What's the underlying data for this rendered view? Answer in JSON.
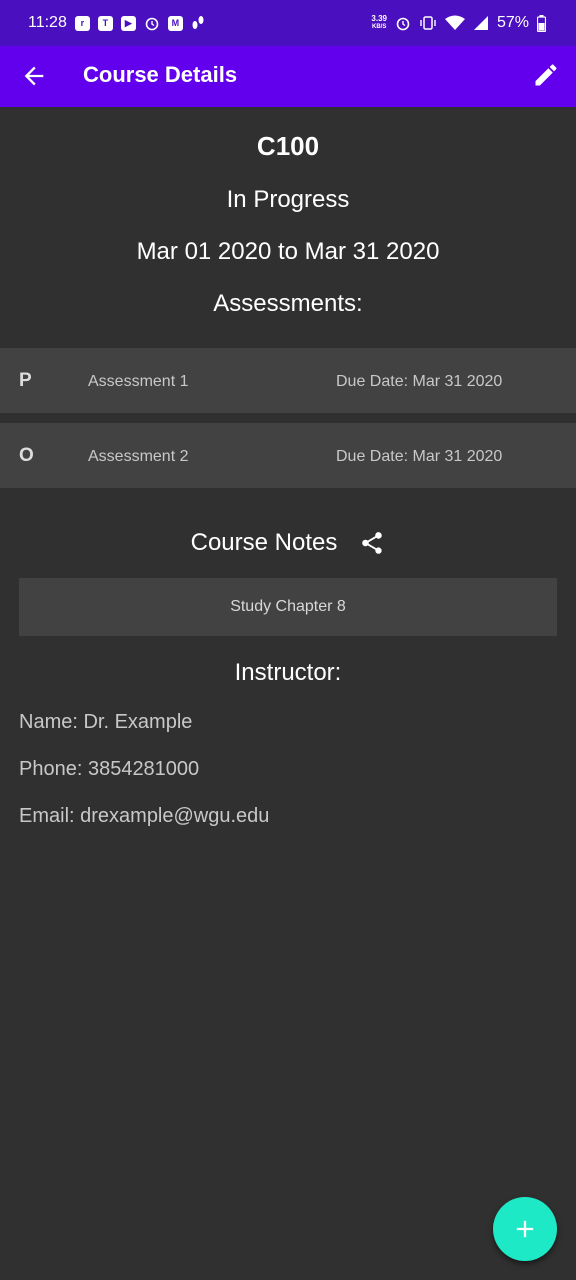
{
  "status_bar": {
    "time": "11:28",
    "left_icons": [
      "ring",
      "teams",
      "youtube",
      "alarm",
      "gmail",
      "fitness"
    ],
    "net_speed_value": "3.39",
    "net_speed_unit": "KB/S",
    "battery": "57%"
  },
  "app_bar": {
    "title": "Course Details",
    "back_icon": "arrow-left-icon",
    "edit_icon": "pencil-icon"
  },
  "course": {
    "code": "C100",
    "status": "In Progress",
    "dates": "Mar 01 2020 to Mar 31 2020"
  },
  "assessments": {
    "heading": "Assessments:",
    "items": [
      {
        "type": "P",
        "name": "Assessment 1",
        "due": "Due Date: Mar 31 2020"
      },
      {
        "type": "O",
        "name": "Assessment 2",
        "due": "Due Date: Mar 31 2020"
      }
    ]
  },
  "notes": {
    "heading": "Course Notes",
    "items": [
      {
        "text": "Study Chapter 8"
      }
    ]
  },
  "instructor": {
    "heading": "Instructor:",
    "name": "Name: Dr. Example",
    "phone": "Phone: 3854281000",
    "email": "Email: drexample@wgu.edu"
  },
  "fab": {
    "icon": "plus-icon"
  },
  "colors": {
    "app_bar": "#6200ee",
    "status_bar": "#4a0fbf",
    "background": "#303030",
    "row": "#424242",
    "fab": "#1de9c6"
  }
}
